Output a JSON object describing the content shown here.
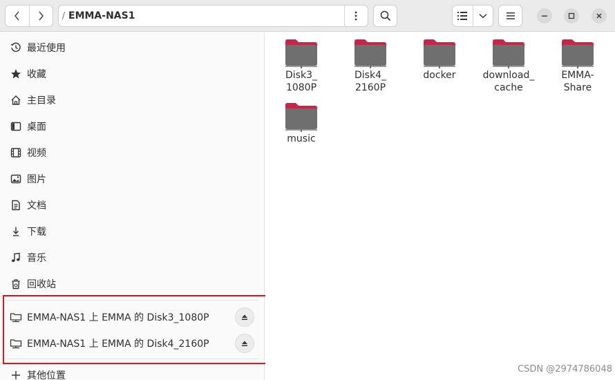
{
  "header": {
    "path_root": "/",
    "path_current": "EMMA-NAS1"
  },
  "sidebar": {
    "places": [
      {
        "label": "最近使用",
        "icon": "clock-icon"
      },
      {
        "label": "收藏",
        "icon": "star-icon"
      },
      {
        "label": "主目录",
        "icon": "home-icon"
      },
      {
        "label": "桌面",
        "icon": "desktop-icon"
      },
      {
        "label": "视频",
        "icon": "film-icon"
      },
      {
        "label": "图片",
        "icon": "image-icon"
      },
      {
        "label": "文档",
        "icon": "document-icon"
      },
      {
        "label": "下载",
        "icon": "download-icon"
      },
      {
        "label": "音乐",
        "icon": "music-icon"
      },
      {
        "label": "回收站",
        "icon": "trash-icon"
      }
    ],
    "mounts": [
      {
        "label": "EMMA-NAS1 上 EMMA 的 Disk3_1080P",
        "icon": "network-drive-icon"
      },
      {
        "label": "EMMA-NAS1 上 EMMA 的 Disk4_2160P",
        "icon": "network-drive-icon"
      }
    ],
    "other_locations": "其他位置"
  },
  "folders": [
    {
      "line1": "Disk3_",
      "line2": "1080P"
    },
    {
      "line1": "Disk4_",
      "line2": "2160P"
    },
    {
      "line1": "docker",
      "line2": ""
    },
    {
      "line1": "download_",
      "line2": "cache"
    },
    {
      "line1": "EMMA-",
      "line2": "Share"
    },
    {
      "line1": "music",
      "line2": ""
    }
  ],
  "watermark": "CSDN @2974786048",
  "colors": {
    "folder_tab": "#c3284a",
    "folder_body": "#6f6f6f",
    "highlight_border": "#e0151c"
  }
}
